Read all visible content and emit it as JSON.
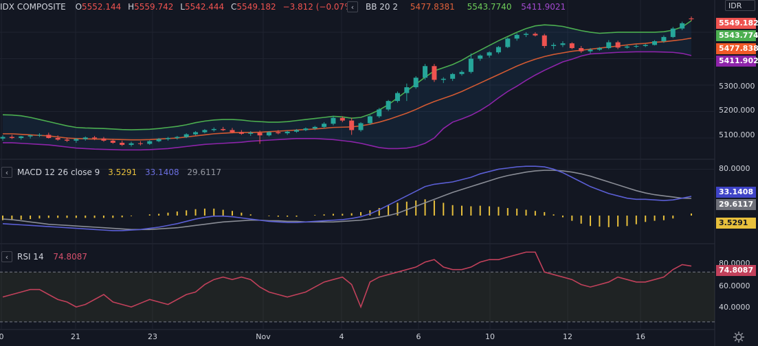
{
  "symbol": {
    "name": "IDX COMPOSITE",
    "open_label": "O",
    "open": "5552.144",
    "high_label": "H",
    "high": "5559.742",
    "low_label": "L",
    "low": "5542.444",
    "close_label": "C",
    "close": "5549.182",
    "change": "−3.812 (−0.07%)"
  },
  "currency": "IDR",
  "bb_legend": {
    "name": "BB 20 2",
    "basis": "5477.8381",
    "upper": "5543.7740",
    "lower": "5411.9021"
  },
  "macd_legend": {
    "name": "MACD 12 26 close 9",
    "hist": "3.5291",
    "macd": "33.1408",
    "signal": "29.6117"
  },
  "rsi_legend": {
    "name": "RSI 14",
    "value": "74.8087"
  },
  "price_axis": {
    "ticks": [
      "5100.000",
      "5200.000",
      "5300.000"
    ],
    "tags": {
      "close": "5549.182",
      "upper": "5543.774",
      "basis": "5477.838",
      "lower": "5411.902"
    }
  },
  "macd_axis": {
    "ticks": [
      "80.0000"
    ],
    "tags": {
      "macd": "33.1408",
      "signal": "29.6117",
      "hist": "3.5291"
    }
  },
  "rsi_axis": {
    "ticks": [
      "80.0000",
      "60.0000",
      "40.0000"
    ],
    "tags": {
      "rsi": "74.8087"
    }
  },
  "time_axis": [
    "0",
    "21",
    "23",
    "Nov",
    "4",
    "6",
    "10",
    "12",
    "16"
  ],
  "colors": {
    "up": "#26a69a",
    "down": "#ef5350",
    "bb_upper": "#4caf50",
    "bb_basis": "#d35a32",
    "bb_lower": "#8e24aa",
    "macd": "#5b5fd6",
    "signal": "#8a8d96",
    "hist": "#e8c03c",
    "rsi": "#c2415b"
  },
  "chart_data": [
    {
      "type": "candlestick",
      "title": "IDX COMPOSITE",
      "ylim": [
        5030,
        5570
      ],
      "candles": [
        {
          "o": 5098,
          "h": 5110,
          "l": 5090,
          "c": 5104
        },
        {
          "o": 5104,
          "h": 5112,
          "l": 5096,
          "c": 5100
        },
        {
          "o": 5100,
          "h": 5108,
          "l": 5094,
          "c": 5106
        },
        {
          "o": 5106,
          "h": 5113,
          "l": 5098,
          "c": 5110
        },
        {
          "o": 5110,
          "h": 5118,
          "l": 5104,
          "c": 5112
        },
        {
          "o": 5112,
          "h": 5120,
          "l": 5098,
          "c": 5100
        },
        {
          "o": 5100,
          "h": 5110,
          "l": 5090,
          "c": 5094
        },
        {
          "o": 5094,
          "h": 5102,
          "l": 5085,
          "c": 5090
        },
        {
          "o": 5090,
          "h": 5100,
          "l": 5082,
          "c": 5096
        },
        {
          "o": 5096,
          "h": 5106,
          "l": 5090,
          "c": 5102
        },
        {
          "o": 5102,
          "h": 5108,
          "l": 5092,
          "c": 5098
        },
        {
          "o": 5098,
          "h": 5104,
          "l": 5086,
          "c": 5090
        },
        {
          "o": 5090,
          "h": 5096,
          "l": 5078,
          "c": 5082
        },
        {
          "o": 5082,
          "h": 5090,
          "l": 5070,
          "c": 5074
        },
        {
          "o": 5074,
          "h": 5086,
          "l": 5068,
          "c": 5080
        },
        {
          "o": 5080,
          "h": 5088,
          "l": 5072,
          "c": 5078
        },
        {
          "o": 5078,
          "h": 5092,
          "l": 5074,
          "c": 5088
        },
        {
          "o": 5088,
          "h": 5100,
          "l": 5084,
          "c": 5096
        },
        {
          "o": 5096,
          "h": 5104,
          "l": 5090,
          "c": 5100
        },
        {
          "o": 5100,
          "h": 5108,
          "l": 5094,
          "c": 5104
        },
        {
          "o": 5104,
          "h": 5118,
          "l": 5100,
          "c": 5114
        },
        {
          "o": 5114,
          "h": 5126,
          "l": 5110,
          "c": 5122
        },
        {
          "o": 5122,
          "h": 5134,
          "l": 5118,
          "c": 5130
        },
        {
          "o": 5130,
          "h": 5140,
          "l": 5124,
          "c": 5134
        },
        {
          "o": 5134,
          "h": 5142,
          "l": 5126,
          "c": 5130
        },
        {
          "o": 5130,
          "h": 5138,
          "l": 5118,
          "c": 5122
        },
        {
          "o": 5122,
          "h": 5130,
          "l": 5112,
          "c": 5116
        },
        {
          "o": 5116,
          "h": 5126,
          "l": 5108,
          "c": 5120
        },
        {
          "o": 5120,
          "h": 5128,
          "l": 5078,
          "c": 5110
        },
        {
          "o": 5110,
          "h": 5126,
          "l": 5106,
          "c": 5122
        },
        {
          "o": 5122,
          "h": 5130,
          "l": 5114,
          "c": 5118
        },
        {
          "o": 5118,
          "h": 5128,
          "l": 5112,
          "c": 5124
        },
        {
          "o": 5124,
          "h": 5134,
          "l": 5120,
          "c": 5130
        },
        {
          "o": 5130,
          "h": 5140,
          "l": 5126,
          "c": 5136
        },
        {
          "o": 5136,
          "h": 5146,
          "l": 5130,
          "c": 5142
        },
        {
          "o": 5142,
          "h": 5160,
          "l": 5136,
          "c": 5154
        },
        {
          "o": 5154,
          "h": 5184,
          "l": 5148,
          "c": 5176
        },
        {
          "o": 5176,
          "h": 5182,
          "l": 5160,
          "c": 5166
        },
        {
          "o": 5166,
          "h": 5176,
          "l": 5112,
          "c": 5130
        },
        {
          "o": 5130,
          "h": 5160,
          "l": 5124,
          "c": 5156
        },
        {
          "o": 5156,
          "h": 5186,
          "l": 5150,
          "c": 5182
        },
        {
          "o": 5182,
          "h": 5214,
          "l": 5176,
          "c": 5208
        },
        {
          "o": 5208,
          "h": 5244,
          "l": 5202,
          "c": 5240
        },
        {
          "o": 5240,
          "h": 5276,
          "l": 5234,
          "c": 5270
        },
        {
          "o": 5270,
          "h": 5306,
          "l": 5240,
          "c": 5292
        },
        {
          "o": 5292,
          "h": 5334,
          "l": 5286,
          "c": 5328
        },
        {
          "o": 5328,
          "h": 5380,
          "l": 5320,
          "c": 5372
        },
        {
          "o": 5372,
          "h": 5380,
          "l": 5312,
          "c": 5320
        },
        {
          "o": 5320,
          "h": 5330,
          "l": 5308,
          "c": 5324
        },
        {
          "o": 5324,
          "h": 5346,
          "l": 5316,
          "c": 5342
        },
        {
          "o": 5342,
          "h": 5356,
          "l": 5336,
          "c": 5350
        },
        {
          "o": 5350,
          "h": 5420,
          "l": 5344,
          "c": 5400
        },
        {
          "o": 5400,
          "h": 5416,
          "l": 5392,
          "c": 5412
        },
        {
          "o": 5412,
          "h": 5428,
          "l": 5404,
          "c": 5424
        },
        {
          "o": 5424,
          "h": 5448,
          "l": 5418,
          "c": 5444
        },
        {
          "o": 5444,
          "h": 5480,
          "l": 5440,
          "c": 5476
        },
        {
          "o": 5476,
          "h": 5496,
          "l": 5468,
          "c": 5490
        },
        {
          "o": 5490,
          "h": 5500,
          "l": 5482,
          "c": 5494
        },
        {
          "o": 5494,
          "h": 5500,
          "l": 5484,
          "c": 5488
        },
        {
          "o": 5488,
          "h": 5494,
          "l": 5440,
          "c": 5448
        },
        {
          "o": 5448,
          "h": 5460,
          "l": 5436,
          "c": 5452
        },
        {
          "o": 5452,
          "h": 5466,
          "l": 5444,
          "c": 5458
        },
        {
          "o": 5458,
          "h": 5462,
          "l": 5436,
          "c": 5440
        },
        {
          "o": 5440,
          "h": 5448,
          "l": 5422,
          "c": 5428
        },
        {
          "o": 5428,
          "h": 5440,
          "l": 5420,
          "c": 5434
        },
        {
          "o": 5434,
          "h": 5444,
          "l": 5430,
          "c": 5440
        },
        {
          "o": 5440,
          "h": 5470,
          "l": 5436,
          "c": 5462
        },
        {
          "o": 5462,
          "h": 5468,
          "l": 5436,
          "c": 5442
        },
        {
          "o": 5442,
          "h": 5452,
          "l": 5438,
          "c": 5446
        },
        {
          "o": 5446,
          "h": 5454,
          "l": 5440,
          "c": 5448
        },
        {
          "o": 5448,
          "h": 5456,
          "l": 5444,
          "c": 5452
        },
        {
          "o": 5452,
          "h": 5470,
          "l": 5450,
          "c": 5466
        },
        {
          "o": 5466,
          "h": 5488,
          "l": 5460,
          "c": 5482
        },
        {
          "o": 5482,
          "h": 5520,
          "l": 5478,
          "c": 5514
        },
        {
          "o": 5514,
          "h": 5540,
          "l": 5508,
          "c": 5534
        },
        {
          "o": 5552.144,
          "h": 5559.742,
          "l": 5542.444,
          "c": 5549.182
        }
      ]
    },
    {
      "type": "line",
      "name": "BB 20 2",
      "ylim": [
        5030,
        5570
      ],
      "series": [
        {
          "name": "upper",
          "values": [
            5188,
            5187,
            5184,
            5178,
            5170,
            5162,
            5154,
            5146,
            5140,
            5138,
            5137,
            5136,
            5134,
            5132,
            5131,
            5132,
            5133,
            5136,
            5140,
            5144,
            5150,
            5158,
            5164,
            5168,
            5170,
            5170,
            5168,
            5164,
            5162,
            5160,
            5160,
            5162,
            5166,
            5170,
            5174,
            5178,
            5182,
            5180,
            5175,
            5178,
            5190,
            5206,
            5226,
            5252,
            5278,
            5304,
            5330,
            5354,
            5366,
            5378,
            5394,
            5414,
            5432,
            5450,
            5468,
            5484,
            5500,
            5514,
            5524,
            5528,
            5526,
            5522,
            5514,
            5506,
            5500,
            5496,
            5498,
            5500,
            5500,
            5500,
            5500,
            5500,
            5502,
            5508,
            5520,
            5543.774
          ]
        },
        {
          "name": "basis",
          "values": [
            5116,
            5116,
            5114,
            5112,
            5110,
            5108,
            5104,
            5100,
            5098,
            5097,
            5096,
            5096,
            5095,
            5094,
            5093,
            5093,
            5094,
            5096,
            5098,
            5100,
            5104,
            5108,
            5112,
            5116,
            5118,
            5120,
            5121,
            5121,
            5122,
            5124,
            5126,
            5128,
            5130,
            5132,
            5134,
            5137,
            5140,
            5141,
            5142,
            5146,
            5152,
            5160,
            5170,
            5182,
            5194,
            5208,
            5224,
            5238,
            5250,
            5262,
            5276,
            5292,
            5308,
            5324,
            5340,
            5356,
            5372,
            5386,
            5398,
            5408,
            5416,
            5422,
            5428,
            5432,
            5436,
            5440,
            5444,
            5448,
            5452,
            5456,
            5458,
            5462,
            5464,
            5468,
            5472,
            5477.838
          ]
        },
        {
          "name": "lower",
          "values": [
            5082,
            5082,
            5080,
            5078,
            5076,
            5074,
            5070,
            5066,
            5062,
            5060,
            5058,
            5057,
            5056,
            5055,
            5055,
            5055,
            5056,
            5058,
            5060,
            5064,
            5068,
            5072,
            5076,
            5078,
            5080,
            5082,
            5084,
            5088,
            5090,
            5092,
            5094,
            5096,
            5098,
            5098,
            5098,
            5096,
            5094,
            5090,
            5086,
            5080,
            5072,
            5064,
            5060,
            5060,
            5062,
            5068,
            5080,
            5100,
            5136,
            5160,
            5172,
            5186,
            5204,
            5226,
            5252,
            5276,
            5296,
            5318,
            5338,
            5356,
            5372,
            5388,
            5398,
            5410,
            5418,
            5420,
            5422,
            5424,
            5425,
            5426,
            5426,
            5426,
            5425,
            5424,
            5420,
            5411.902
          ]
        }
      ]
    },
    {
      "type": "line",
      "name": "MACD 12 26 close 9",
      "series": [
        {
          "name": "MACD",
          "values": [
            -14,
            -15,
            -16,
            -17,
            -18,
            -19,
            -20,
            -21,
            -22,
            -23,
            -24,
            -25,
            -26,
            -26,
            -25,
            -24,
            -22,
            -20,
            -17,
            -14,
            -10,
            -6,
            -3,
            -1,
            -1,
            -2,
            -4,
            -6,
            -8,
            -10,
            -11,
            -12,
            -12,
            -11,
            -10,
            -9,
            -8,
            -7,
            -5,
            -2,
            3,
            10,
            18,
            26,
            34,
            42,
            50,
            54,
            56,
            58,
            62,
            66,
            72,
            76,
            80,
            82,
            84,
            85,
            85,
            84,
            80,
            74,
            66,
            58,
            50,
            44,
            38,
            34,
            30,
            28,
            28,
            27,
            26,
            27,
            30,
            33.1408
          ]
        },
        {
          "name": "signal",
          "values": [
            -6,
            -7,
            -9,
            -11,
            -13,
            -15,
            -16,
            -17,
            -18,
            -19,
            -20,
            -21,
            -22,
            -23,
            -24,
            -24,
            -24,
            -23,
            -22,
            -21,
            -19,
            -17,
            -15,
            -13,
            -11,
            -10,
            -9,
            -8,
            -8,
            -9,
            -9,
            -10,
            -10,
            -11,
            -11,
            -11,
            -11,
            -10,
            -9,
            -8,
            -6,
            -3,
            0,
            4,
            10,
            16,
            22,
            28,
            34,
            40,
            45,
            50,
            55,
            60,
            65,
            69,
            72,
            75,
            77,
            78,
            78,
            77,
            75,
            72,
            68,
            63,
            58,
            53,
            48,
            43,
            39,
            36,
            34,
            32,
            30,
            29.6117
          ]
        },
        {
          "name": "histogram",
          "values": [
            -8,
            -8,
            -7,
            -6,
            -5,
            -4,
            -4,
            -4,
            -4,
            -4,
            -4,
            -4,
            -4,
            -3,
            -1,
            0,
            2,
            3,
            5,
            7,
            9,
            11,
            12,
            12,
            10,
            8,
            5,
            2,
            0,
            -1,
            -2,
            -2,
            -2,
            0,
            1,
            2,
            3,
            3,
            4,
            6,
            9,
            13,
            18,
            22,
            24,
            26,
            28,
            26,
            22,
            18,
            17,
            16,
            17,
            16,
            15,
            13,
            12,
            10,
            8,
            6,
            2,
            -3,
            -9,
            -14,
            -18,
            -19,
            -20,
            -19,
            -18,
            -15,
            -11,
            -9,
            -8,
            -5,
            0,
            3.5291
          ]
        }
      ]
    },
    {
      "type": "line",
      "name": "RSI 14",
      "ylim": [
        25,
        90
      ],
      "levels": [
        70,
        30
      ],
      "series": [
        {
          "name": "RSI",
          "values": [
            50,
            52,
            54,
            56,
            56,
            52,
            48,
            46,
            42,
            44,
            48,
            52,
            46,
            44,
            42,
            45,
            48,
            46,
            44,
            48,
            52,
            54,
            60,
            64,
            66,
            64,
            66,
            64,
            58,
            54,
            52,
            50,
            52,
            54,
            58,
            62,
            64,
            66,
            60,
            42,
            62,
            66,
            68,
            70,
            72,
            74,
            78,
            80,
            74,
            72,
            72,
            74,
            78,
            80,
            80,
            82,
            84,
            86,
            86,
            70,
            68,
            66,
            64,
            60,
            58,
            60,
            62,
            66,
            64,
            62,
            62,
            64,
            66,
            72,
            76,
            74.8087
          ]
        }
      ]
    }
  ]
}
